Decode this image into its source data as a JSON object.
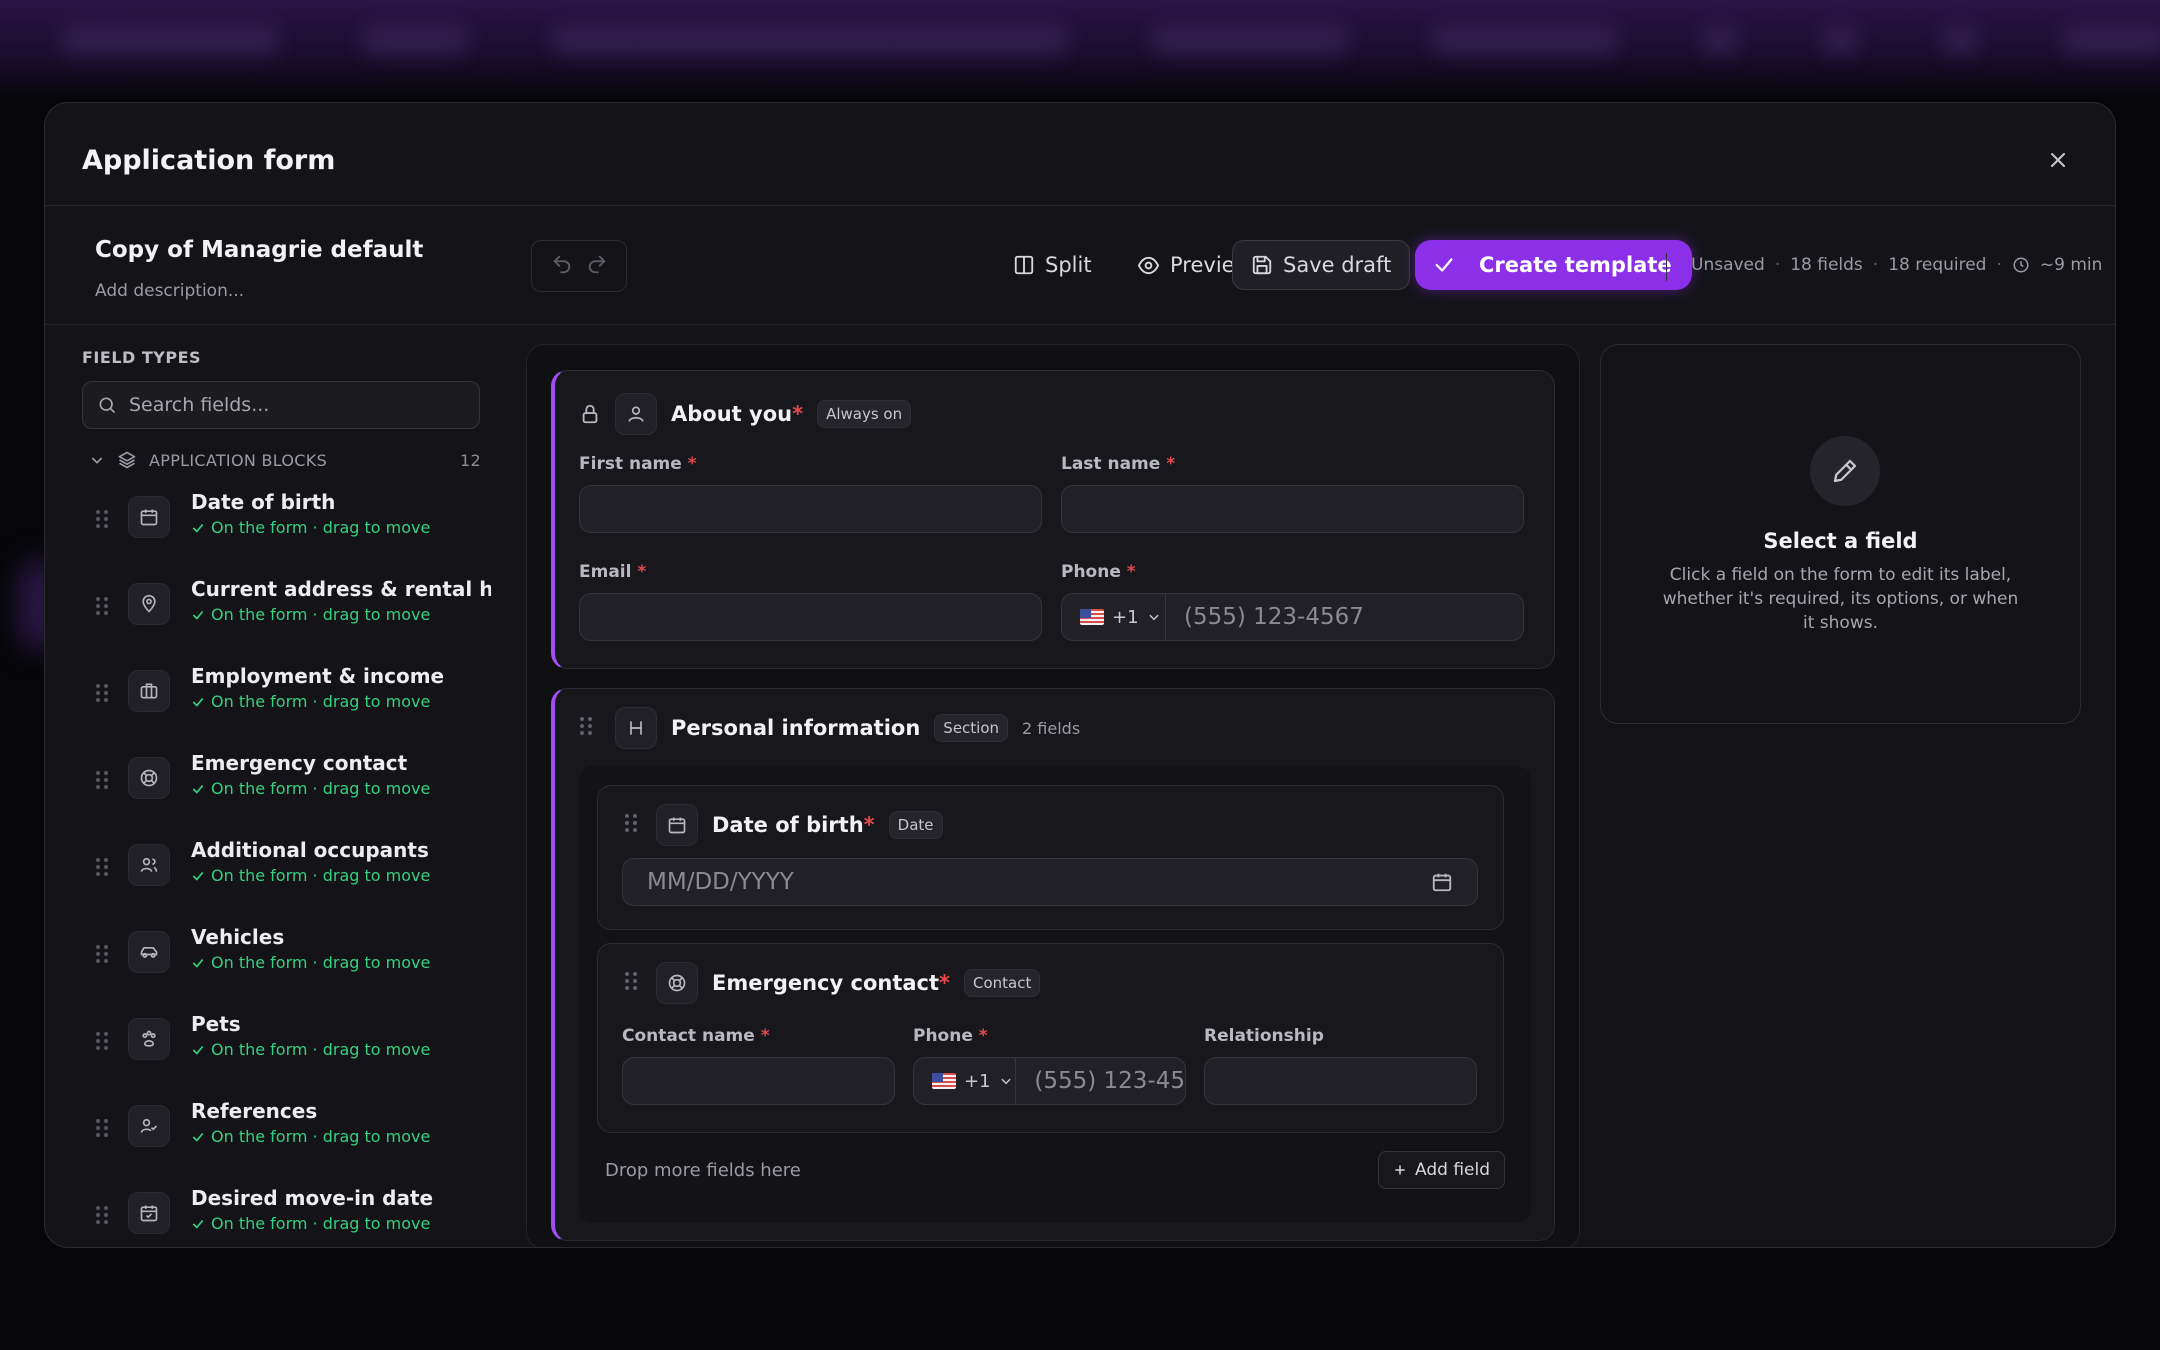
{
  "modal": {
    "title": "Application form",
    "close_label": "×"
  },
  "toolbar": {
    "template_name": "Copy of Managrie default",
    "description_placeholder": "Add description...",
    "split_label": "Split",
    "preview_label": "Preview",
    "save_draft_label": "Save draft",
    "create_template_label": "Create template",
    "status": {
      "saved_state": "Unsaved",
      "fields": "18 fields",
      "required": "18 required",
      "duration": "~9 min",
      "separator": "·"
    }
  },
  "sidebar": {
    "field_types_title": "FIELD TYPES",
    "search_placeholder": "Search fields...",
    "blocks_title": "APPLICATION BLOCKS",
    "blocks_count": "12",
    "status_text": "On the form · drag to move",
    "blocks": [
      {
        "label": "Date of birth",
        "icon": "calendar-icon"
      },
      {
        "label": "Current address & rental hi...",
        "icon": "map-pin-icon"
      },
      {
        "label": "Employment & income",
        "icon": "briefcase-icon"
      },
      {
        "label": "Emergency contact",
        "icon": "lifebuoy-icon"
      },
      {
        "label": "Additional occupants",
        "icon": "users-icon"
      },
      {
        "label": "Vehicles",
        "icon": "car-icon"
      },
      {
        "label": "Pets",
        "icon": "paw-icon"
      },
      {
        "label": "References",
        "icon": "user-check-icon"
      },
      {
        "label": "Desired move-in date",
        "icon": "calendar-check-icon"
      }
    ]
  },
  "about": {
    "title": "About you",
    "badge": "Always on",
    "required_mark": "*",
    "first_name_label": "First name",
    "last_name_label": "Last name",
    "email_label": "Email",
    "phone_label": "Phone",
    "country_code": "+1",
    "phone_placeholder": "(555) 123-4567"
  },
  "personal": {
    "title": "Personal information",
    "badge": "Section",
    "field_count": "2 fields",
    "dob": {
      "title": "Date of birth",
      "badge": "Date",
      "placeholder": "MM/DD/YYYY"
    },
    "emergency": {
      "title": "Emergency contact",
      "badge": "Contact",
      "contact_name_label": "Contact name",
      "phone_label": "Phone",
      "relationship_label": "Relationship",
      "country_code": "+1",
      "phone_placeholder": "(555) 123-45"
    },
    "drop_text": "Drop more fields here",
    "add_field_label": "Add field"
  },
  "inspector": {
    "title": "Select a field",
    "description": "Click a field on the form to edit its label, whether it's required, its options, or when it shows."
  },
  "colors": {
    "accent": "#8b2fe8",
    "success": "#35d07f",
    "required": "#e5484d"
  }
}
